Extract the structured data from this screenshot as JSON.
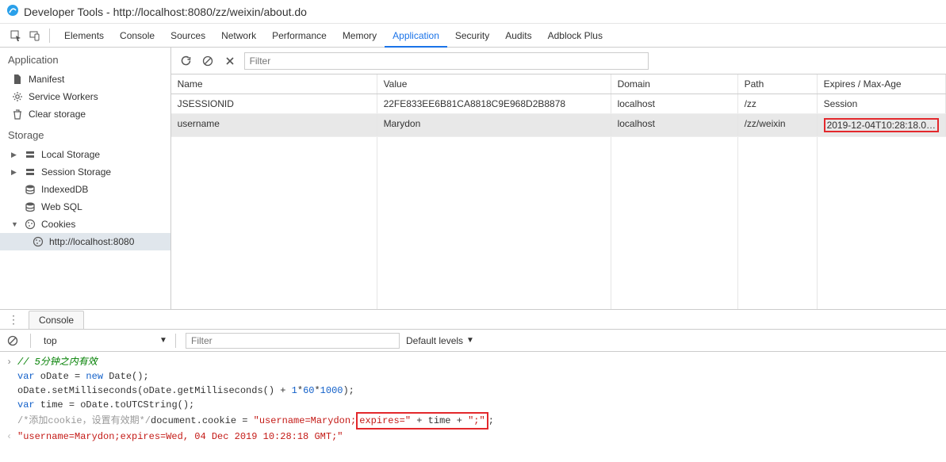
{
  "window": {
    "title": "Developer Tools - http://localhost:8080/zz/weixin/about.do"
  },
  "tabs": {
    "items": [
      "Elements",
      "Console",
      "Sources",
      "Network",
      "Performance",
      "Memory",
      "Application",
      "Security",
      "Audits",
      "Adblock Plus"
    ],
    "active": "Application"
  },
  "sidebar": {
    "application_title": "Application",
    "manifest": "Manifest",
    "service_workers": "Service Workers",
    "clear_storage": "Clear storage",
    "storage_title": "Storage",
    "local_storage": "Local Storage",
    "session_storage": "Session Storage",
    "indexeddb": "IndexedDB",
    "web_sql": "Web SQL",
    "cookies": "Cookies",
    "cookies_origin": "http://localhost:8080"
  },
  "main_toolbar": {
    "filter_placeholder": "Filter"
  },
  "cookies_table": {
    "headers": {
      "name": "Name",
      "value": "Value",
      "domain": "Domain",
      "path": "Path",
      "expires": "Expires / Max-Age"
    },
    "rows": [
      {
        "name": "JSESSIONID",
        "value": "22FE833EE6B81CA8818C9E968D2B8878",
        "domain": "localhost",
        "path": "/zz",
        "expires": "Session",
        "selected": false,
        "highlight_expires": false
      },
      {
        "name": "username",
        "value": "Marydon",
        "domain": "localhost",
        "path": "/zz/weixin",
        "expires": "2019-12-04T10:28:18.0…",
        "selected": true,
        "highlight_expires": true
      }
    ]
  },
  "drawer": {
    "console_tab": "Console",
    "context": "top",
    "filter_placeholder": "Filter",
    "levels": "Default levels"
  },
  "console_code": {
    "line1_comment": "// 5分钟之内有效",
    "line2_a": "var",
    "line2_b": " oDate = ",
    "line2_c": "new",
    "line2_d": " Date();",
    "line3": "oDate.setMilliseconds(oDate.getMilliseconds() + ",
    "line3_n1": "1",
    "line3_m": "*",
    "line3_n2": "60",
    "line3_m2": "*",
    "line3_n3": "1000",
    "line3_end": ");",
    "line4_a": "var",
    "line4_b": " time = oDate.toUTCString();",
    "line5_c1": "/*添加cookie，设置有效期*/",
    "line5_b": "document.cookie = ",
    "line5_s1": "\"username=Marydon;",
    "line5_s2": "expires=\"",
    "line5_p": " + time + ",
    "line5_s3": "\";\"",
    "line5_end": ";",
    "result": "\"username=Marydon;expires=Wed, 04 Dec 2019 10:28:18 GMT;\""
  }
}
